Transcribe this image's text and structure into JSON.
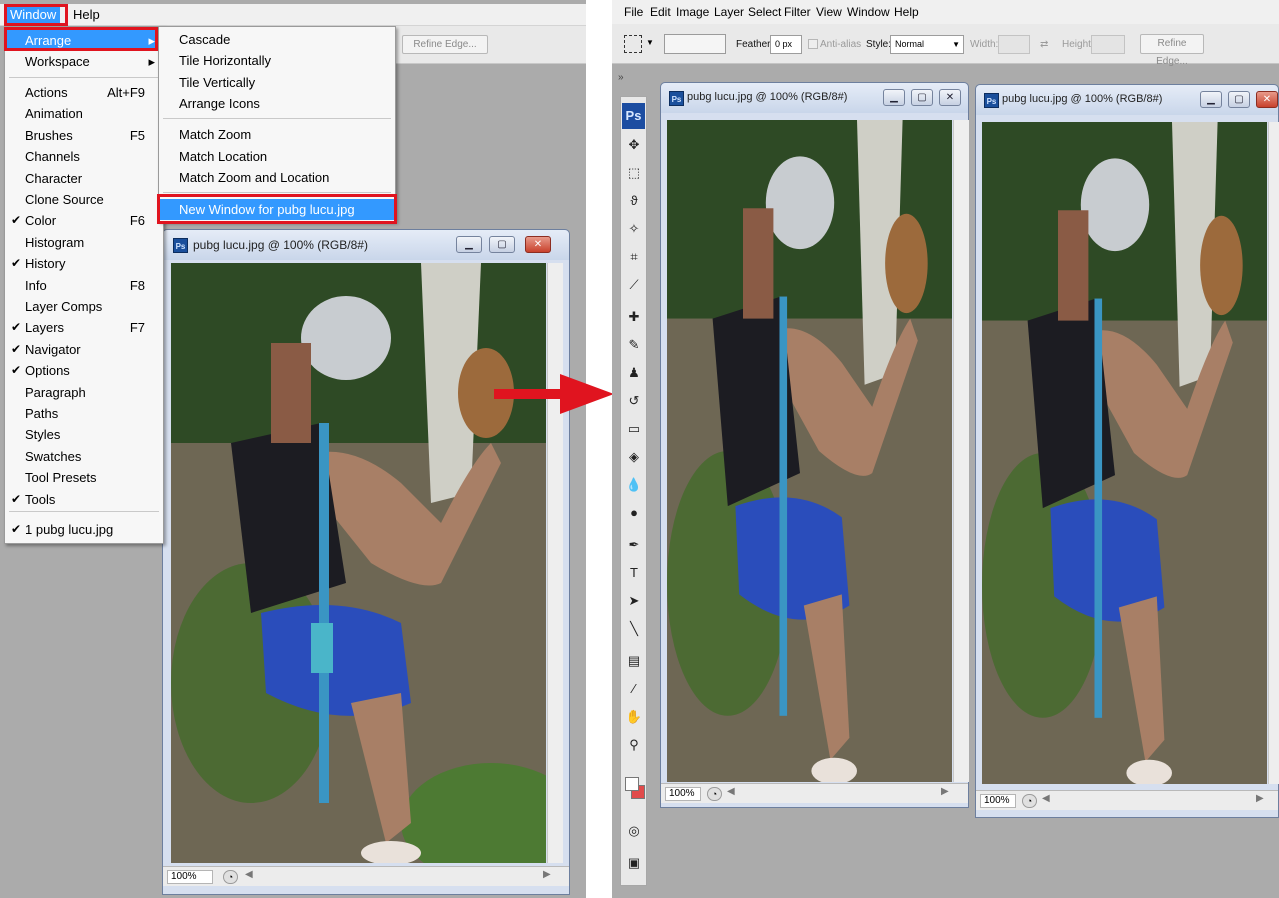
{
  "left_panel": {
    "menubar": {
      "window": "Window",
      "help": "Help"
    },
    "options_bar": {
      "refine_edge": "Refine Edge..."
    },
    "window_menu": {
      "arrange": "Arrange",
      "workspace": "Workspace",
      "items": [
        {
          "label": "Actions",
          "shortcut": "Alt+F9",
          "checked": false
        },
        {
          "label": "Animation",
          "shortcut": "",
          "checked": false
        },
        {
          "label": "Brushes",
          "shortcut": "F5",
          "checked": false
        },
        {
          "label": "Channels",
          "shortcut": "",
          "checked": false
        },
        {
          "label": "Character",
          "shortcut": "",
          "checked": false
        },
        {
          "label": "Clone Source",
          "shortcut": "",
          "checked": false
        },
        {
          "label": "Color",
          "shortcut": "F6",
          "checked": true
        },
        {
          "label": "Histogram",
          "shortcut": "",
          "checked": false
        },
        {
          "label": "History",
          "shortcut": "",
          "checked": true
        },
        {
          "label": "Info",
          "shortcut": "F8",
          "checked": false
        },
        {
          "label": "Layer Comps",
          "shortcut": "",
          "checked": false
        },
        {
          "label": "Layers",
          "shortcut": "F7",
          "checked": true
        },
        {
          "label": "Navigator",
          "shortcut": "",
          "checked": true
        },
        {
          "label": "Options",
          "shortcut": "",
          "checked": true
        },
        {
          "label": "Paragraph",
          "shortcut": "",
          "checked": false
        },
        {
          "label": "Paths",
          "shortcut": "",
          "checked": false
        },
        {
          "label": "Styles",
          "shortcut": "",
          "checked": false
        },
        {
          "label": "Swatches",
          "shortcut": "",
          "checked": false
        },
        {
          "label": "Tool Presets",
          "shortcut": "",
          "checked": false
        },
        {
          "label": "Tools",
          "shortcut": "",
          "checked": true
        }
      ],
      "open_doc": "1 pubg lucu.jpg"
    },
    "arrange_submenu": {
      "cascade": "Cascade",
      "tile_horizontally": "Tile Horizontally",
      "tile_vertically": "Tile Vertically",
      "arrange_icons": "Arrange Icons",
      "match_zoom": "Match Zoom",
      "match_location": "Match Location",
      "match_zoom_location": "Match Zoom and Location",
      "new_window": "New Window for pubg lucu.jpg"
    },
    "document": {
      "title": "pubg lucu.jpg @ 100% (RGB/8#)",
      "zoom": "100%"
    }
  },
  "right_panel": {
    "menubar": [
      "File",
      "Edit",
      "Image",
      "Layer",
      "Select",
      "Filter",
      "View",
      "Window",
      "Help"
    ],
    "options_bar": {
      "feather_label": "Feather:",
      "feather_value": "0 px",
      "anti_alias": "Anti-alias",
      "style_label": "Style:",
      "style_value": "Normal",
      "width_label": "Width:",
      "height_label": "Height:",
      "refine_edge": "Refine Edge..."
    },
    "toolbox_logo": "Ps",
    "documents": [
      {
        "title": "pubg lucu.jpg @ 100% (RGB/8#)",
        "zoom": "100%"
      },
      {
        "title": "pubg lucu.jpg @ 100% (RGB/8#)",
        "zoom": "100%"
      }
    ]
  },
  "colors": {
    "highlight": "#3399ff",
    "annotation_red": "#e0141f",
    "window_bg": "#ababab"
  },
  "icons": [
    "check-icon",
    "submenu-arrow-icon",
    "minimize-icon",
    "maximize-icon",
    "close-icon",
    "navigator-icon",
    "ps-logo-icon",
    "red-arrow-icon"
  ]
}
